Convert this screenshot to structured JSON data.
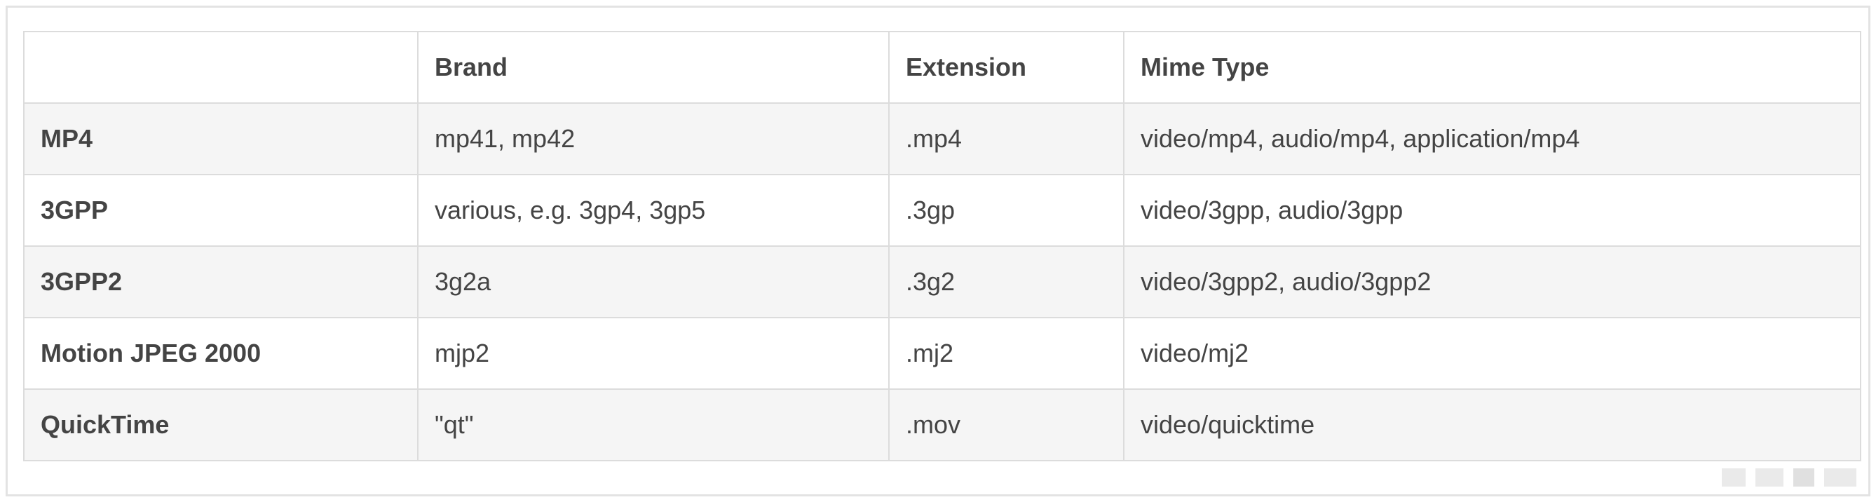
{
  "table": {
    "headers": [
      "",
      "Brand",
      "Extension",
      "Mime Type"
    ],
    "rows": [
      {
        "name": "MP4",
        "brand": "mp41, mp42",
        "extension": ".mp4",
        "mime": "video/mp4, audio/mp4, application/mp4"
      },
      {
        "name": "3GPP",
        "brand": "various, e.g. 3gp4, 3gp5",
        "extension": ".3gp",
        "mime": "video/3gpp, audio/3gpp"
      },
      {
        "name": "3GPP2",
        "brand": "3g2a",
        "extension": ".3g2",
        "mime": "video/3gpp2, audio/3gpp2"
      },
      {
        "name": "Motion JPEG 2000",
        "brand": "mjp2",
        "extension": ".mj2",
        "mime": "video/mj2"
      },
      {
        "name": "QuickTime",
        "brand": "\"qt\"",
        "extension": ".mov",
        "mime": "video/quicktime"
      }
    ]
  },
  "colors": {
    "border": "#dcdcdc",
    "stripe": "#f5f5f5",
    "text": "#444444"
  }
}
